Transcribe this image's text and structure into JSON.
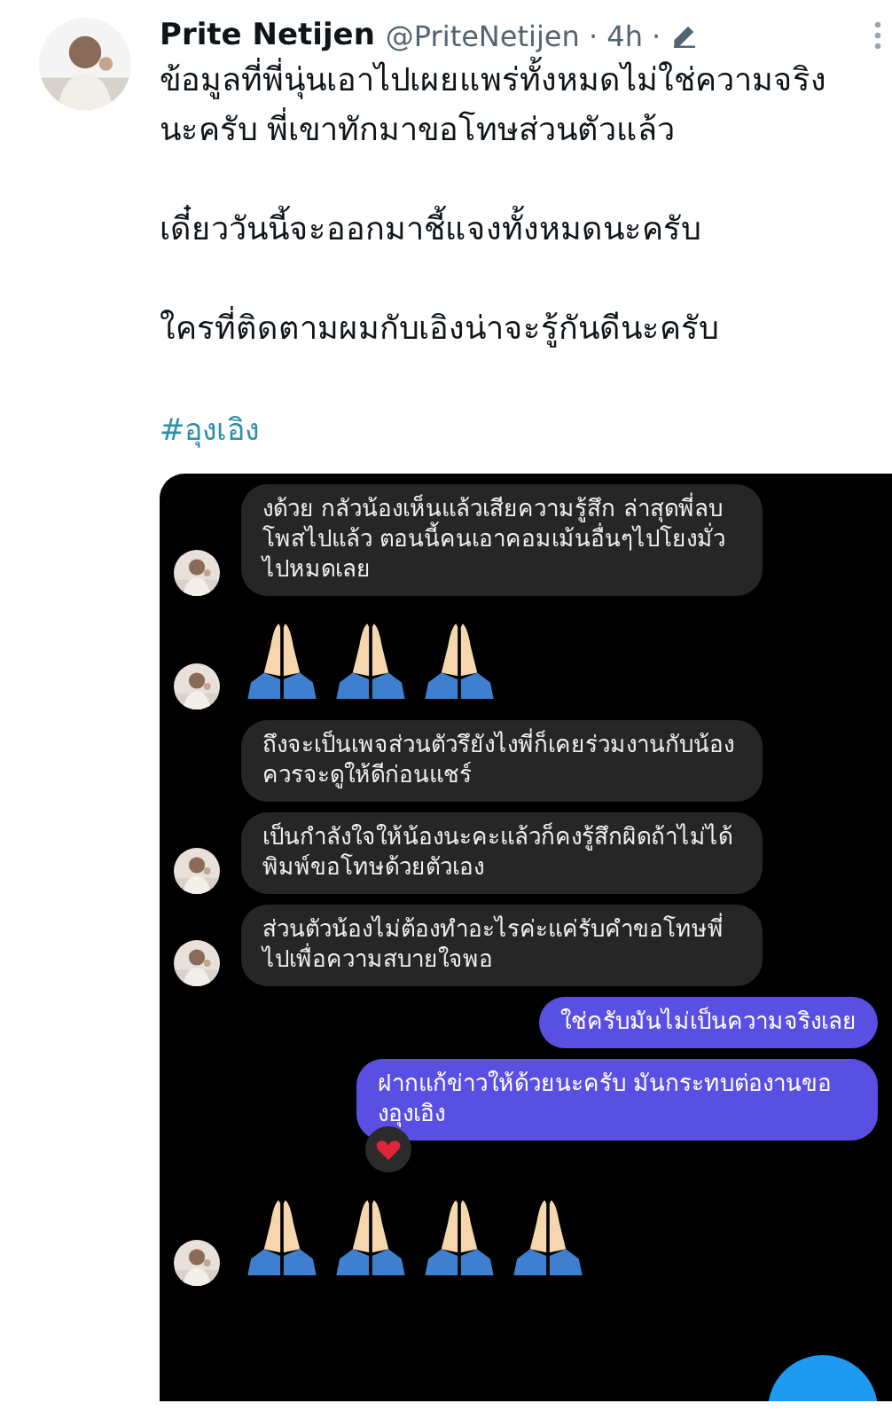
{
  "tweet": {
    "author": "Prite Netijen",
    "handle": "@PriteNetijen · 4h ·",
    "paragraphs": [
      "ข้อมูลที่พี่นุ่นเอาไปเผยแพร่ทั้งหมดไม่ใช่ความจริงนะครับ พี่เขาทักมาขอโทษส่วนตัวแล้ว",
      "เดี๋ยววันนี้จะออกมาชี้แจงทั้งหมดนะครับ",
      "ใครที่ติดตามผมกับเอิงน่าจะรู้กันดีนะครับ"
    ],
    "hashtag": "#อุงเอิง"
  },
  "chat": {
    "messages": [
      {
        "kind": "text",
        "sent": false,
        "avatar": true,
        "text": "งด้วย กลัวน้องเห็นแล้วเสียความรู้สึก ล่าสุดพี่ลบโพสไปแล้ว ตอนนี้คนเอาคอมเม้นอื่นๆไปโยงมั่วไปหมดเลย"
      },
      {
        "kind": "emoji",
        "sent": false,
        "avatar": true,
        "items": [
          {
            "kind": "praying_hands"
          },
          {
            "kind": "praying_hands"
          },
          {
            "kind": "praying_hands"
          }
        ]
      },
      {
        "kind": "text",
        "sent": false,
        "avatar": false,
        "text": "ถึงจะเป็นเพจส่วนตัวรึยังไงพี่ก็เคยร่วมงานกับน้องควรจะดูให้ดีก่อนแชร์"
      },
      {
        "kind": "text",
        "sent": false,
        "avatar": true,
        "text": "เป็นกำลังใจให้น้องนะคะแล้วก็คงรู้สึกผิดถ้าไม่ได้พิมพ์ขอโทษด้วยตัวเอง"
      },
      {
        "kind": "text",
        "sent": false,
        "avatar": true,
        "text": "ส่วนตัวน้องไม่ต้องทำอะไรค่ะแค่รับคำขอโทษพี่ไปเพื่อความสบายใจพอ"
      },
      {
        "kind": "text",
        "sent": true,
        "text": "ใช่ครับมันไม่เป็นความจริงเลย"
      },
      {
        "kind": "text",
        "sent": true,
        "text": "ฝากแก้ข่าวให้ด้วยนะครับ มันกระทบต่องานของอุงเอิง",
        "reaction": {
          "kind": "heart"
        }
      },
      {
        "kind": "emoji",
        "sent": false,
        "avatar": true,
        "items": [
          {
            "kind": "praying_hands"
          },
          {
            "kind": "praying_hands"
          },
          {
            "kind": "praying_hands"
          },
          {
            "kind": "praying_hands"
          }
        ]
      }
    ]
  }
}
